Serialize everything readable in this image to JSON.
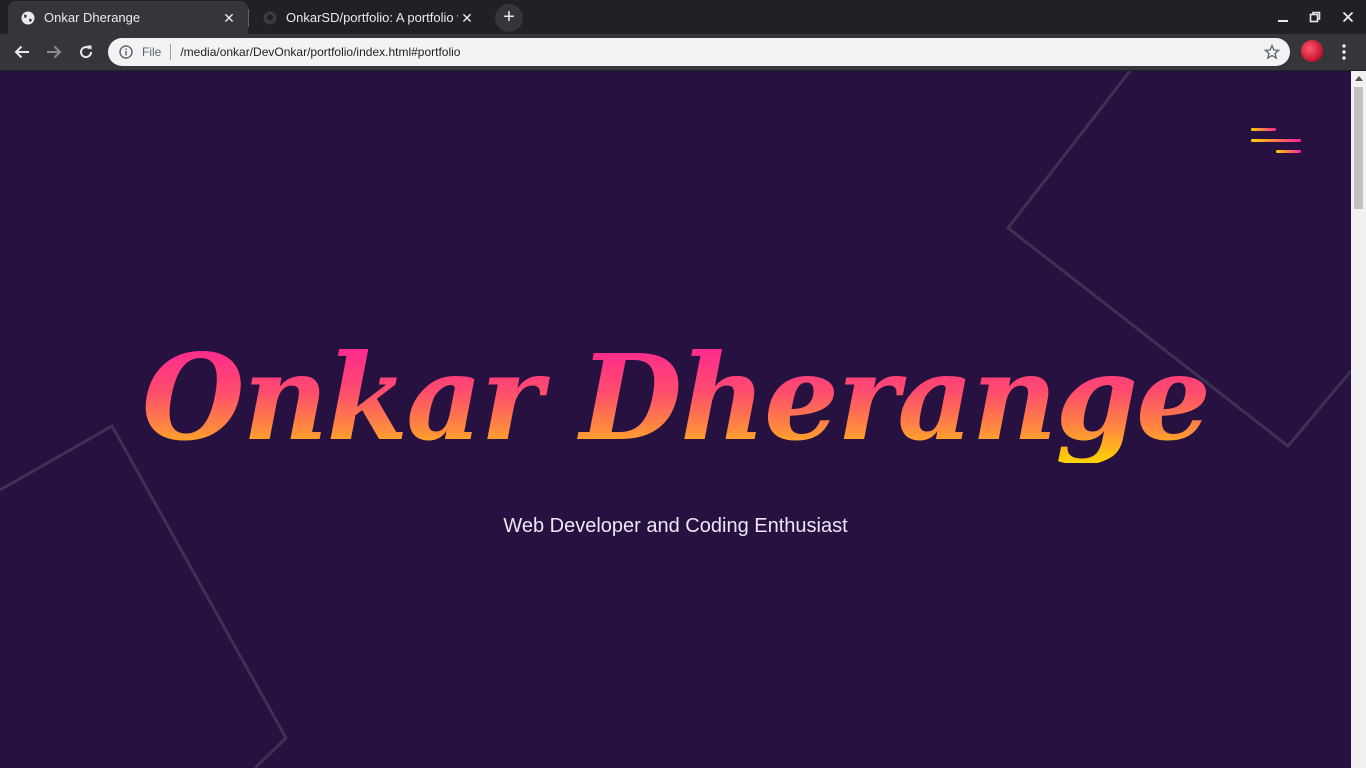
{
  "browser": {
    "tabs": [
      {
        "title": "Onkar Dherange",
        "active": true
      },
      {
        "title": "OnkarSD/portfolio: A portfolio website",
        "active": false
      }
    ],
    "new_tab_label": "+",
    "address": {
      "scheme_label": "File",
      "url": "/media/onkar/DevOnkar/portfolio/index.html#portfolio"
    }
  },
  "page": {
    "name": "Onkar Dherange",
    "tagline": "Web Developer and Coding Enthusiast"
  },
  "colors": {
    "page_background": "#261141",
    "gradient_top": "#ff1e9a",
    "gradient_mid": "#ff8d3c",
    "gradient_bottom": "#ffd500",
    "deco_lines": "#3f3152"
  },
  "icons": {
    "tab_favicon": "globe-icon",
    "tab2_favicon": "github-icon",
    "menu": "hamburger-menu-icon"
  }
}
